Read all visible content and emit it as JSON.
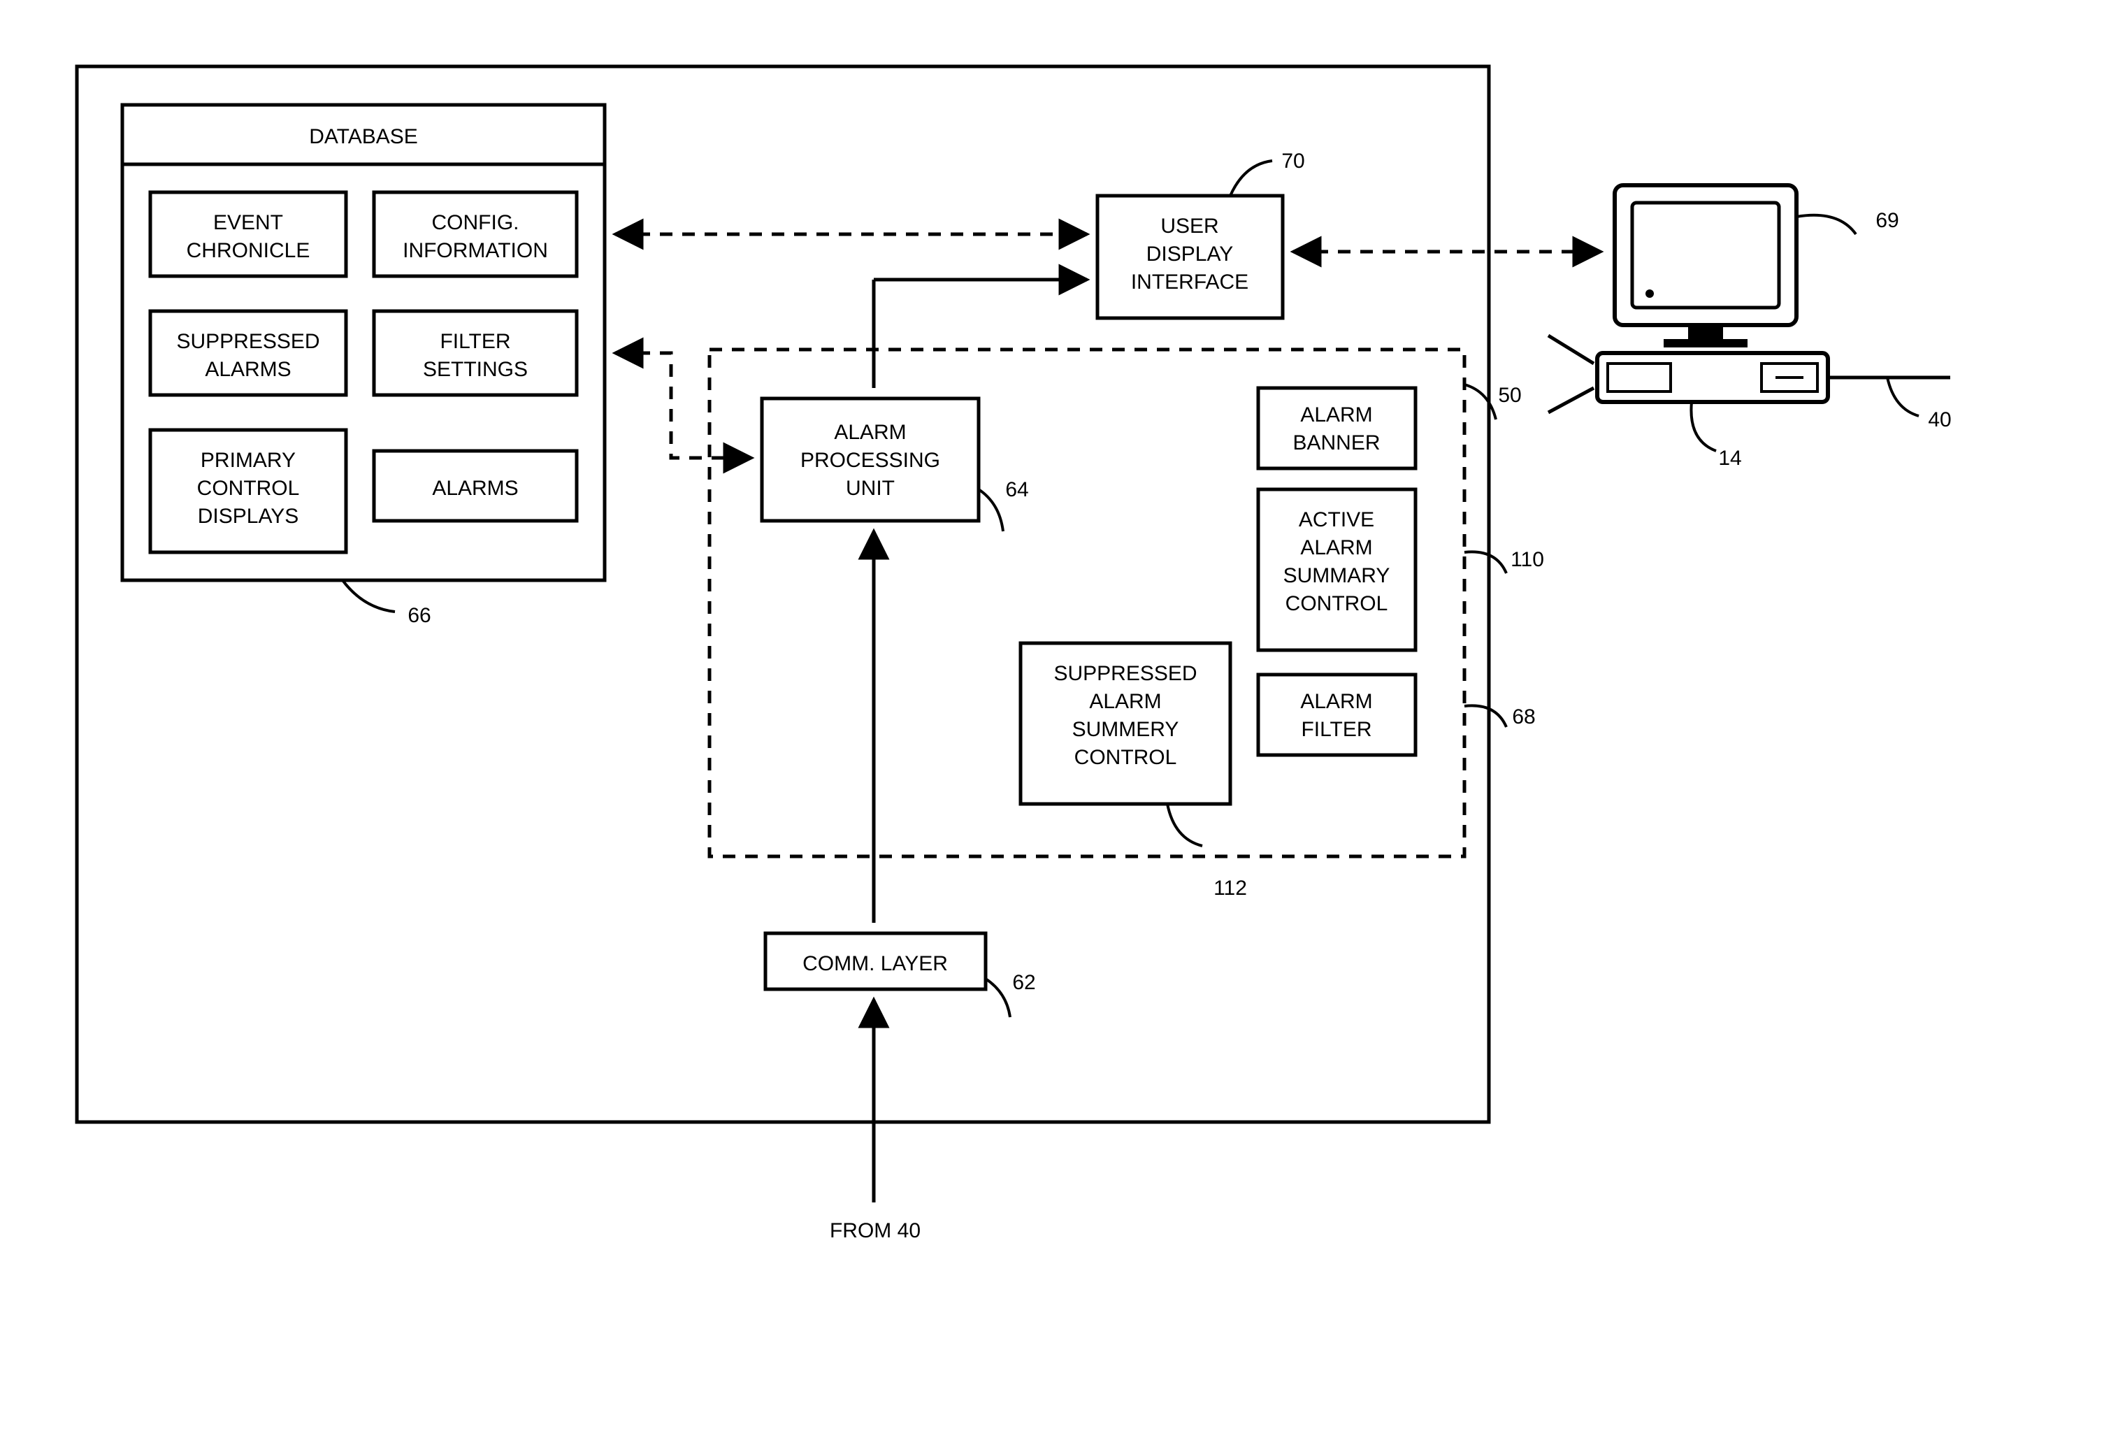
{
  "database": {
    "title": "DATABASE",
    "ref": "66",
    "items": [
      "EVENT CHRONICLE",
      "CONFIG. INFORMATION",
      "SUPPRESSED ALARMS",
      "FILTER SETTINGS",
      "PRIMARY CONTROL DISPLAYS",
      "ALARMS"
    ]
  },
  "user_display_interface": {
    "label": "USER DISPLAY INTERFACE",
    "ref": "70"
  },
  "alarm_processing_unit": {
    "label": "ALARM PROCESSING UNIT",
    "ref": "64"
  },
  "comm_layer": {
    "label": "COMM. LAYER",
    "ref": "62"
  },
  "alarm_banner": {
    "label": "ALARM BANNER",
    "ref": "50"
  },
  "active_alarm_summary": {
    "label": "ACTIVE ALARM SUMMARY CONTROL",
    "ref": "110"
  },
  "suppressed_summery": {
    "label": "SUPPRESSED ALARM SUMMERY CONTROL",
    "ref": "112"
  },
  "alarm_filter": {
    "label": "ALARM FILTER",
    "ref": "68"
  },
  "from_label": "FROM 40",
  "computer": {
    "monitor_ref": "69",
    "tower_ref": "14",
    "net_ref": "40"
  }
}
